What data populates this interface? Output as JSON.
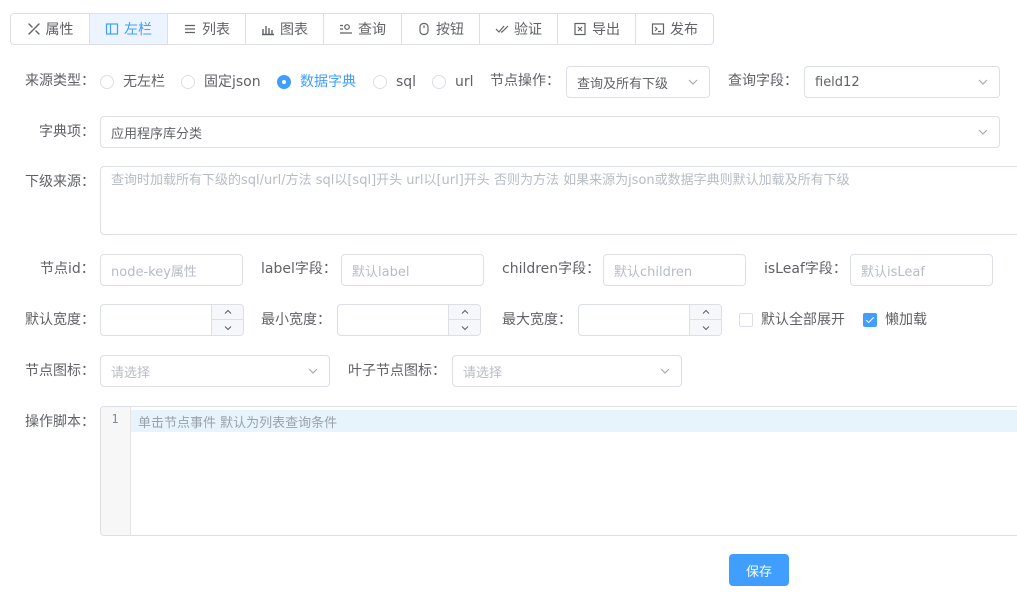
{
  "tabs": [
    {
      "label": "属性",
      "icon": "wrench-icon",
      "active": false
    },
    {
      "label": "左栏",
      "icon": "sidebar-layout-icon",
      "active": true
    },
    {
      "label": "列表",
      "icon": "list-icon",
      "active": false
    },
    {
      "label": "图表",
      "icon": "bar-chart-icon",
      "active": false
    },
    {
      "label": "查询",
      "icon": "query-icon",
      "active": false
    },
    {
      "label": "按钮",
      "icon": "button-icon",
      "active": false
    },
    {
      "label": "验证",
      "icon": "check-icon",
      "active": false
    },
    {
      "label": "导出",
      "icon": "export-icon",
      "active": false
    },
    {
      "label": "发布",
      "icon": "terminal-icon",
      "active": false
    }
  ],
  "colors": {
    "accent": "#409eff",
    "border": "#dcdfe6",
    "text": "#606266",
    "placeholder": "#b7bcc5"
  },
  "source": {
    "label": "来源类型：",
    "options": [
      "无左栏",
      "固定json",
      "数据字典",
      "sql",
      "url"
    ],
    "selected": "数据字典"
  },
  "node_op": {
    "label": "节点操作：",
    "value": "查询及所有下级"
  },
  "query_field": {
    "label": "查询字段：",
    "value": "field12"
  },
  "dict_item": {
    "label": "字典项：",
    "value": "应用程序库分类"
  },
  "sub_source": {
    "label": "下级来源：",
    "placeholder": "查询时加载所有下级的sql/url/方法 sql以[sql]开头 url以[url]开头 否则为方法 如果来源为json或数据字典则默认加载及所有下级"
  },
  "node_fields": {
    "node_id": {
      "label": "节点id：",
      "placeholder": "node-key属性"
    },
    "label_field": {
      "label": "label字段：",
      "placeholder": "默认label"
    },
    "children_field": {
      "label": "children字段：",
      "placeholder": "默认children"
    },
    "isleaf_field": {
      "label": "isLeaf字段：",
      "placeholder": "默认isLeaf"
    }
  },
  "widths": {
    "default_width": {
      "label": "默认宽度："
    },
    "min_width": {
      "label": "最小宽度："
    },
    "max_width": {
      "label": "最大宽度："
    }
  },
  "checks": {
    "expand_all": {
      "label": "默认全部展开",
      "checked": false
    },
    "lazy_load": {
      "label": "懒加载",
      "checked": true
    }
  },
  "icons_row": {
    "node_icon": {
      "label": "节点图标：",
      "placeholder": "请选择"
    },
    "leaf_icon": {
      "label": "叶子节点图标：",
      "placeholder": "请选择"
    }
  },
  "script": {
    "label": "操作脚本：",
    "line_number": "1",
    "placeholder": "单击节点事件 默认为列表查询条件"
  },
  "save_label": "保存"
}
